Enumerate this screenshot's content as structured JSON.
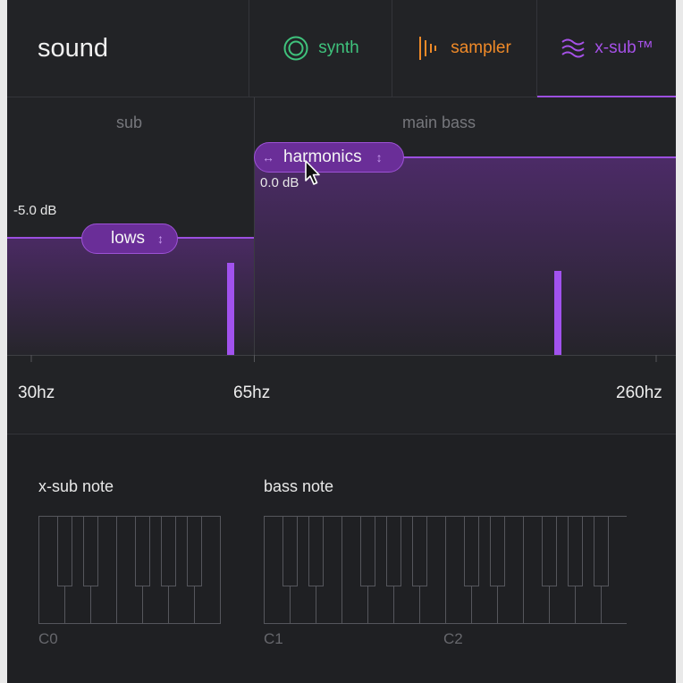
{
  "header": {
    "title": "sound",
    "tabs": [
      {
        "label": "synth",
        "icon": "ring-icon",
        "color": "#3fc27c"
      },
      {
        "label": "sampler",
        "icon": "waveform-bars-icon",
        "color": "#f08a28"
      },
      {
        "label": "x-sub™",
        "icon": "wave-lines-icon",
        "color": "#a651e8",
        "active": true
      }
    ]
  },
  "graph": {
    "sections": [
      "sub",
      "main bass"
    ],
    "sub_level": "-5.0 dB",
    "main_level": "0.0 dB",
    "handles": {
      "lows": {
        "label": "lows",
        "icon": "vertical-arrows-icon"
      },
      "harmonics": {
        "label": "harmonics",
        "icon": "horizontal-arrows-icon"
      }
    },
    "freq_labels": [
      "30hz",
      "65hz",
      "260hz"
    ],
    "accent": "#9c4fe0"
  },
  "keyboards": {
    "xsub": {
      "title": "x-sub note",
      "octaves": [
        "C0"
      ]
    },
    "bass": {
      "title": "bass note",
      "octaves": [
        "C1",
        "C2"
      ]
    }
  }
}
